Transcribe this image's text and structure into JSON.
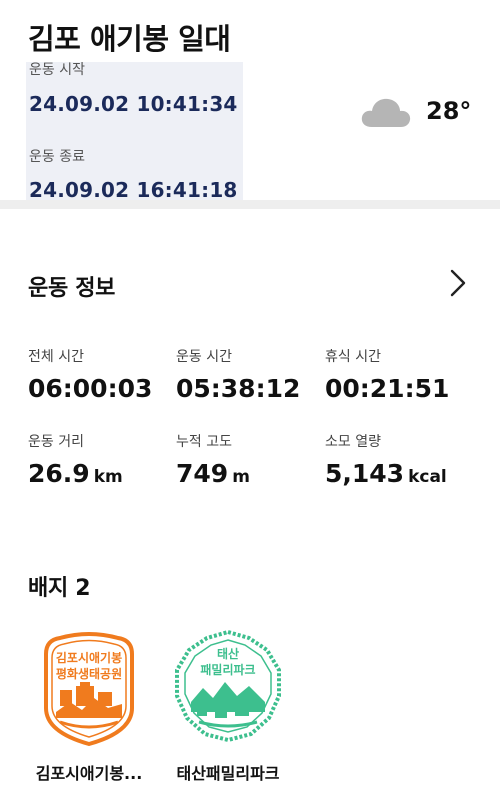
{
  "header": {
    "title": "김포 애기봉 일대",
    "start_label": "운동 시작",
    "start_value": "24.09.02 10:41:34",
    "end_label": "운동 종료",
    "end_value": "24.09.02 16:41:18",
    "weather_icon": "cloud-icon",
    "temperature": "28°"
  },
  "workout_info": {
    "title": "운동 정보",
    "stats": [
      {
        "label": "전체 시간",
        "value": "06:00:03",
        "unit": ""
      },
      {
        "label": "운동 시간",
        "value": "05:38:12",
        "unit": ""
      },
      {
        "label": "휴식 시간",
        "value": "00:21:51",
        "unit": ""
      },
      {
        "label": "운동 거리",
        "value": "26.9",
        "unit": "km"
      },
      {
        "label": "누적 고도",
        "value": "749",
        "unit": "m"
      },
      {
        "label": "소모 열량",
        "value": "5,143",
        "unit": "kcal"
      }
    ]
  },
  "badges": {
    "title": "배지 2",
    "items": [
      {
        "label": "김포시애기봉...",
        "stamp_text_1": "김포시애기봉",
        "stamp_text_2": "평화생태공원",
        "color": "#f07b1e"
      },
      {
        "label": "태산패밀리파크",
        "stamp_text_1": "태산",
        "stamp_text_2": "패밀리파크",
        "color": "#3dbf8e"
      }
    ]
  },
  "colors": {
    "time_value": "#1b2a5a",
    "time_block_bg": "#eef0f6",
    "divider": "#eeeeee"
  }
}
